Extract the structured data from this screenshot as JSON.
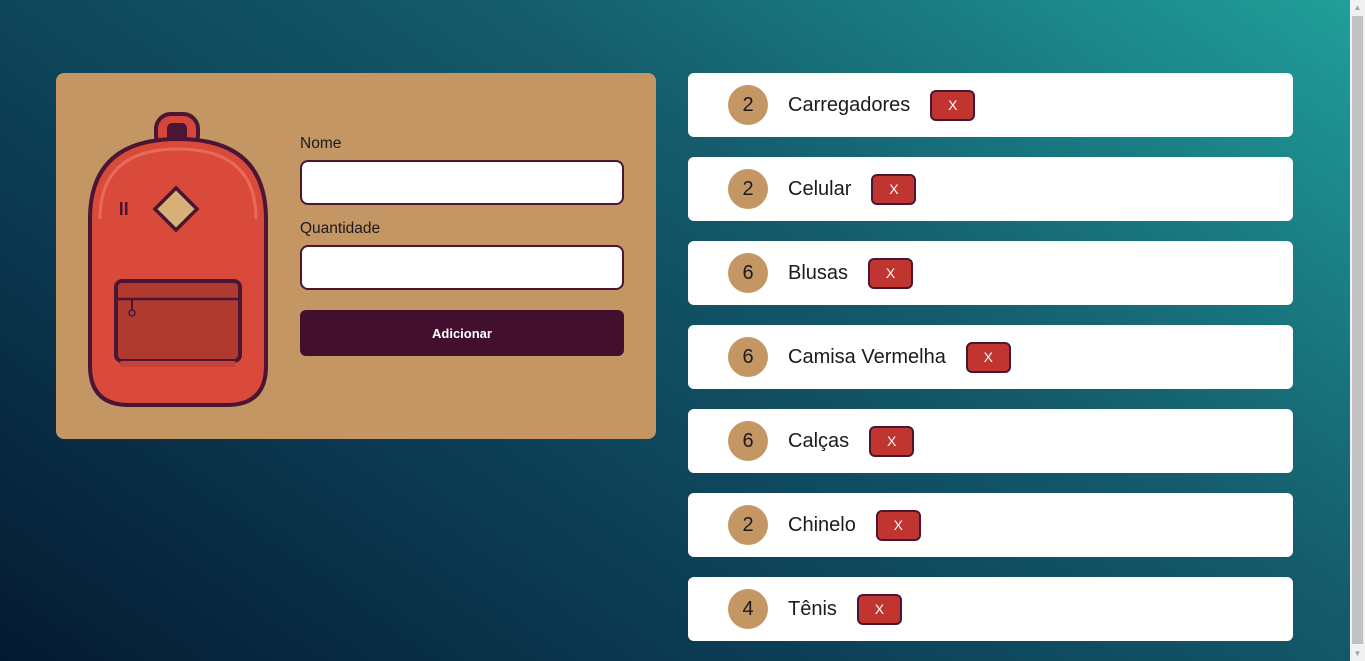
{
  "form": {
    "name_label": "Nome",
    "name_value": "",
    "quantity_label": "Quantidade",
    "quantity_value": "",
    "submit_label": "Adicionar"
  },
  "items": [
    {
      "quantity": "2",
      "name": "Carregadores",
      "delete_label": "X"
    },
    {
      "quantity": "2",
      "name": "Celular",
      "delete_label": "X"
    },
    {
      "quantity": "6",
      "name": "Blusas",
      "delete_label": "X"
    },
    {
      "quantity": "6",
      "name": "Camisa Vermelha",
      "delete_label": "X"
    },
    {
      "quantity": "6",
      "name": "Calças",
      "delete_label": "X"
    },
    {
      "quantity": "2",
      "name": "Chinelo",
      "delete_label": "X"
    },
    {
      "quantity": "4",
      "name": "Tênis",
      "delete_label": "X"
    }
  ],
  "icons": {
    "illustration": "backpack-icon",
    "scroll_up": "scroll-up-arrow-icon",
    "scroll_down": "scroll-down-arrow-icon"
  },
  "colors": {
    "card_background": "#c49663",
    "primary_button": "#42102d",
    "delete_button": "#c03530",
    "quantity_badge": "#c49663",
    "list_item_background": "#ffffff"
  }
}
